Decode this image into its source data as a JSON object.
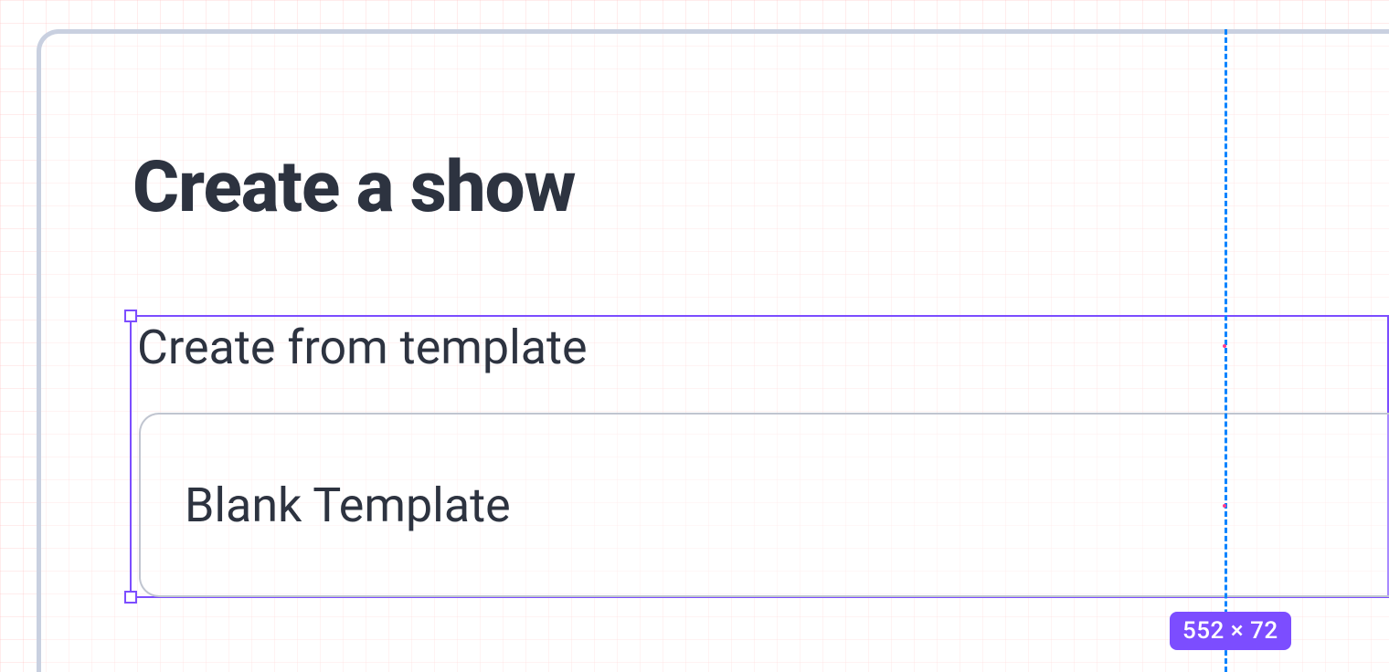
{
  "page": {
    "title": "Create a show",
    "section_label": "Create from template",
    "template_card": {
      "label": "Blank Template"
    }
  },
  "editor": {
    "selection": {
      "dimensions_label": "552 × 72"
    }
  }
}
